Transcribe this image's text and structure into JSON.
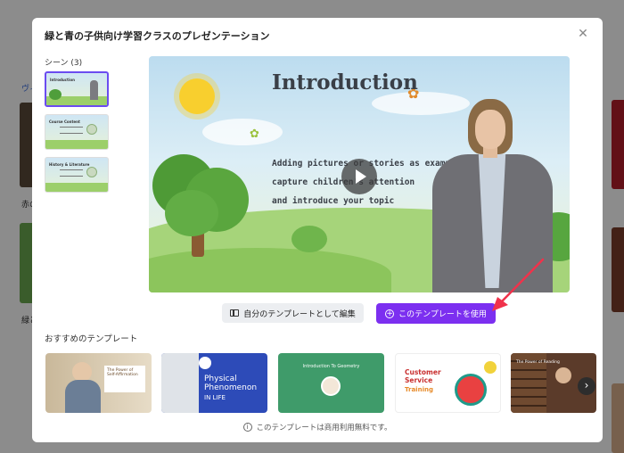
{
  "background": {
    "left_texts": [
      "ヴィ",
      "赤の",
      "緑と"
    ]
  },
  "modal": {
    "title": "緑と青の子供向け学習クラスのプレゼンテーション",
    "close_icon": "close-icon"
  },
  "scenes": {
    "label": "シーン (3)",
    "items": [
      {
        "title": "Introduction"
      },
      {
        "title": "Course Content"
      },
      {
        "title": "History & Literature"
      }
    ]
  },
  "slide": {
    "title": "Introduction",
    "body": "Adding pictures or stories as examples to\ncapture children's attention\nand introduce your topic"
  },
  "actions": {
    "edit_label": "自分のテンプレートとして編集",
    "use_label": "このテンプレートを使用"
  },
  "recommended": {
    "label": "おすすめのテンプレート",
    "items": [
      {
        "title": "The Power of Self-Affirmation"
      },
      {
        "title": "Physical Phenomenon",
        "subtitle": "IN LIFE"
      },
      {
        "title": "Introduction To Geometry"
      },
      {
        "title": "Customer Service",
        "subtitle": "Training"
      },
      {
        "title": "The Power of Reading"
      }
    ]
  },
  "footer": {
    "note": "このテンプレートは商用利用無料です。"
  },
  "colors": {
    "primary": "#7c2ff0",
    "arrow": "#f0324b"
  }
}
